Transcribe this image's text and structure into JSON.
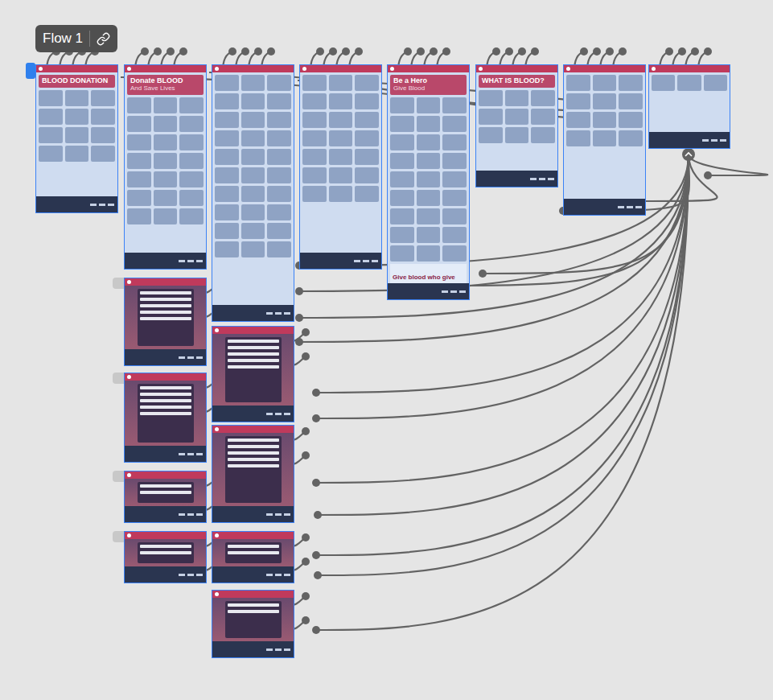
{
  "flow": {
    "label": "Flow 1"
  },
  "frames": [
    {
      "kind": "page",
      "title": "BLOOD DONATION",
      "subtitle": "",
      "banner": "",
      "selected": true
    },
    {
      "kind": "page",
      "title": "Donate BLOOD",
      "subtitle": "And Save Lives",
      "banner": "",
      "selected": true
    },
    {
      "kind": "page",
      "title": "",
      "subtitle": "",
      "banner": "",
      "selected": true
    },
    {
      "kind": "page",
      "title": "",
      "subtitle": "",
      "banner": "",
      "selected": true
    },
    {
      "kind": "page",
      "title": "Be a Hero",
      "subtitle": "Give Blood",
      "banner": "Give blood who give",
      "selected": true
    },
    {
      "kind": "page",
      "title": "WHAT IS BLOOD?",
      "subtitle": "",
      "banner": "",
      "selected": true
    },
    {
      "kind": "page",
      "title": "",
      "subtitle": "",
      "banner": "",
      "selected": true
    },
    {
      "kind": "page",
      "title": "",
      "subtitle": "",
      "banner": "",
      "selected": true
    },
    {
      "kind": "form",
      "title": "",
      "subtitle": "",
      "banner": "",
      "selected": true
    },
    {
      "kind": "form",
      "title": "",
      "subtitle": "",
      "banner": "",
      "selected": true
    },
    {
      "kind": "form",
      "title": "",
      "subtitle": "",
      "banner": "",
      "selected": true
    },
    {
      "kind": "form",
      "title": "",
      "subtitle": "",
      "banner": "",
      "selected": true
    },
    {
      "kind": "form",
      "title": "",
      "subtitle": "",
      "banner": "",
      "selected": true
    },
    {
      "kind": "form",
      "title": "",
      "subtitle": "",
      "banner": "",
      "selected": true
    },
    {
      "kind": "form",
      "title": "",
      "subtitle": "",
      "banner": "",
      "selected": true
    },
    {
      "kind": "form",
      "title": "",
      "subtitle": "",
      "banner": "",
      "selected": true
    }
  ]
}
